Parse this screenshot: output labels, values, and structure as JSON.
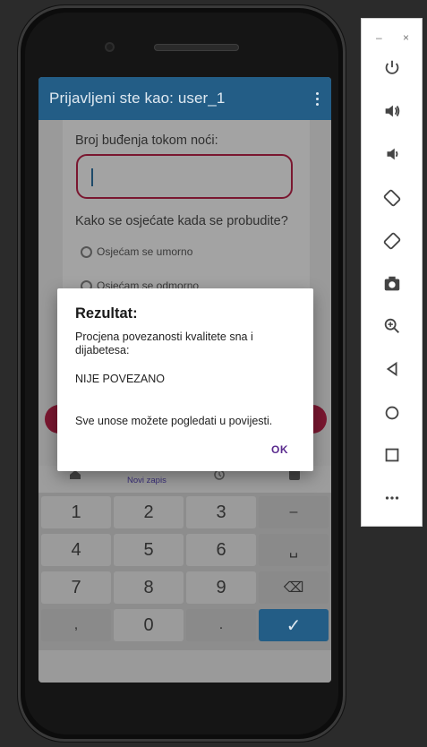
{
  "app": {
    "title": "Prijavljeni ste kao: user_1"
  },
  "form": {
    "question1": "Broj buđenja tokom noći:",
    "input_value": "",
    "question2": "Kako se osjećate kada se probudite?",
    "options": [
      "Osjećam se umorno",
      "Osjećam se odmorno"
    ]
  },
  "bottom_nav": {
    "active_label": "Novi zapis"
  },
  "dialog": {
    "title": "Rezultat:",
    "line1": "Procjena povezanosti kvalitete sna i",
    "line2": "dijabetesa:",
    "result": "NIJE POVEZANO",
    "note": "Sve unose možete pogledati u povijesti.",
    "ok_label": "OK"
  },
  "keypad": {
    "keys": [
      "1",
      "2",
      "3",
      "–",
      "4",
      "5",
      "6",
      "␣",
      "7",
      "8",
      "9",
      "⌫",
      ",",
      "0",
      ".",
      "✓"
    ]
  },
  "toolbar": {
    "minimize": "–",
    "close": "×",
    "buttons": [
      "power-icon",
      "volume-up-icon",
      "volume-down-icon",
      "rotate-left-icon",
      "rotate-right-icon",
      "camera-icon",
      "zoom-icon",
      "back-icon",
      "home-icon",
      "overview-icon",
      "more-icon"
    ]
  },
  "colors": {
    "appbar": "#235d86",
    "accent": "#7a1730",
    "dialog_ok": "#5b2c8f"
  }
}
